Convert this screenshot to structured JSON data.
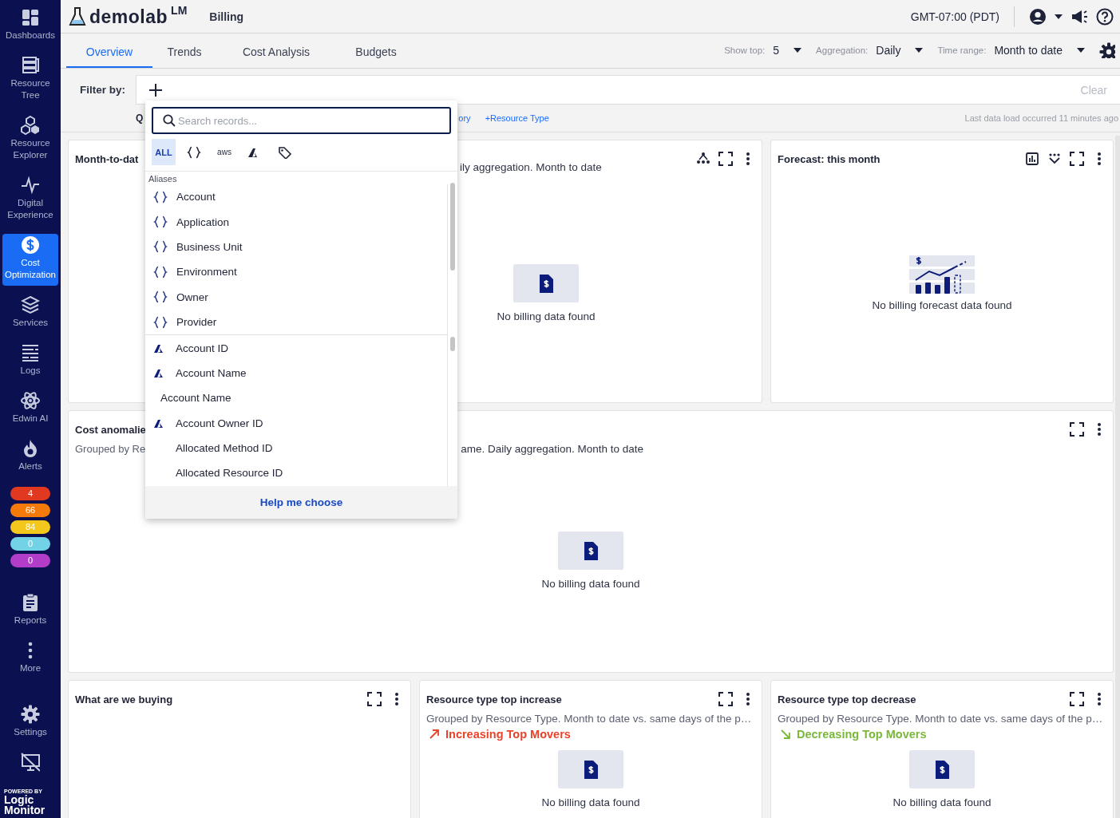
{
  "sidebar": {
    "items": [
      {
        "kind": "dashboards",
        "label": "Dashboards",
        "selected": false
      },
      {
        "kind": "tree",
        "label": "Resource Tree",
        "selected": false
      },
      {
        "kind": "explorer",
        "label": "Resource Explorer",
        "selected": false
      },
      {
        "kind": "pulse",
        "label": "Digital Experience",
        "selected": false
      },
      {
        "kind": "dollar",
        "label": "Cost Optimization",
        "selected": true
      },
      {
        "kind": "layers",
        "label": "Services",
        "selected": false
      },
      {
        "kind": "logs",
        "label": "Logs",
        "selected": false
      },
      {
        "kind": "atom",
        "label": "Edwin AI",
        "selected": false
      },
      {
        "kind": "flame",
        "label": "Alerts",
        "selected": false
      }
    ],
    "alert_counts": [
      {
        "count": "4",
        "color": "#e0391f"
      },
      {
        "count": "66",
        "color": "#f57a0a"
      },
      {
        "count": "84",
        "color": "#f3c71b"
      },
      {
        "count": "0",
        "color": "#72d3e6"
      },
      {
        "count": "0",
        "color": "#b23dc9"
      }
    ],
    "lower_items": [
      {
        "kind": "clipboard",
        "label": "Reports",
        "selected": false
      },
      {
        "kind": "dots",
        "label": "More",
        "selected": false
      },
      {
        "kind": "gear",
        "label": "Settings",
        "selected": false
      },
      {
        "kind": "screen-off",
        "selected": false
      }
    ],
    "brand": {
      "overline": "POWERED BY",
      "line_1": "Logic",
      "line_2": "Monitor"
    }
  },
  "header": {
    "logo": "demolab",
    "logo_mark": "LM",
    "page": "Billing",
    "timezone": "GMT-07:00 (PDT)"
  },
  "tabs": [
    {
      "label": "Overview",
      "selected": true
    },
    {
      "label": "Trends",
      "selected": false
    },
    {
      "label": "Cost Analysis",
      "selected": false
    },
    {
      "label": "Budgets",
      "selected": false
    }
  ],
  "controls": [
    {
      "label": "Show top:",
      "value": "5"
    },
    {
      "label": "Aggregation:",
      "value": "Daily"
    },
    {
      "label": "Time range:",
      "value": "Month to date"
    }
  ],
  "filter": {
    "label": "Filter by:",
    "clear": "Clear"
  },
  "quick_filters": {
    "label": "Q",
    "links": [
      "ory",
      "+Resource Type"
    ],
    "last_load": "Last data load occurred 11 minutes ago"
  },
  "cards": [
    {
      "kind": "summary",
      "title": "Month-to-dat",
      "subtitle": "ily aggregation. Month to date",
      "empty": {
        "kind": "doc",
        "text": "No billing data found"
      }
    },
    {
      "kind": "forecast",
      "title": "Forecast: this month",
      "empty": {
        "kind": "forecast",
        "text": "No billing forecast data found"
      }
    },
    {
      "kind": "anomalies",
      "title": "Cost anomalie",
      "subtitle": "Grouped by Re",
      "subtitle_tail": "ame. Daily aggregation. Month to date",
      "empty": {
        "kind": "doc",
        "text": "No billing data found"
      }
    },
    {
      "kind": "plain",
      "title": "What are we buying"
    },
    {
      "kind": "plain",
      "title": "Resource type top increase",
      "subtitle": "Grouped by Resource Type. Month to date vs. same days of the p…",
      "trend": {
        "kind": "increase",
        "label": "Increasing Top Movers"
      },
      "empty": {
        "kind": "doc",
        "text": "No billing data found"
      }
    },
    {
      "kind": "plain",
      "title": "Resource type top decrease",
      "subtitle": "Grouped by Resource Type. Month to date vs. same days of the p…",
      "trend": {
        "kind": "decrease",
        "label": "Decreasing Top Movers"
      },
      "empty": {
        "kind": "doc",
        "text": "No billing data found"
      }
    }
  ],
  "picker": {
    "placeholder": "Search records...",
    "types": [
      {
        "kind": "all",
        "label": "ALL",
        "selected": true
      },
      {
        "kind": "alias",
        "selected": false
      },
      {
        "kind": "aws",
        "label": "aws",
        "selected": false
      },
      {
        "kind": "cloud",
        "selected": false
      },
      {
        "kind": "tag",
        "selected": false
      }
    ],
    "section": "Aliases",
    "aliases": [
      {
        "kind": "alias",
        "label": "Account"
      },
      {
        "kind": "alias",
        "label": "Application"
      },
      {
        "kind": "alias",
        "label": "Business Unit"
      },
      {
        "kind": "alias",
        "label": "Environment"
      },
      {
        "kind": "alias",
        "label": "Owner"
      },
      {
        "kind": "alias",
        "label": "Provider"
      }
    ],
    "fields": [
      {
        "kind": "cloud",
        "label": "Account ID"
      },
      {
        "kind": "cloud",
        "label": "Account Name"
      },
      {
        "kind": "bare",
        "label": "Account Name"
      },
      {
        "kind": "cloud",
        "label": "Account Owner ID"
      },
      {
        "kind": "blank",
        "label": "Allocated Method ID"
      },
      {
        "kind": "blank",
        "label": "Allocated Resource ID"
      }
    ],
    "help": "Help me choose"
  }
}
